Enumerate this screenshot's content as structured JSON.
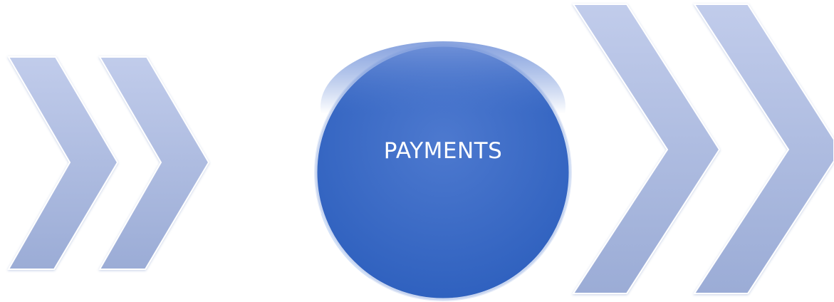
{
  "diagram": {
    "center_label": "PAYMENTS",
    "colors": {
      "chevron_fill_top": "#bcc8e6",
      "chevron_fill_bottom": "#9eafd7",
      "chevron_highlight": "#ffffff",
      "circle_fill_top": "#6486d2",
      "circle_fill_bottom": "#2f63bf",
      "circle_rim": "#d7e2f6",
      "label_color": "#ffffff"
    },
    "icons": {
      "left_chevrons": "double-chevron-right-icon",
      "right_chevrons": "double-chevron-right-icon"
    }
  }
}
